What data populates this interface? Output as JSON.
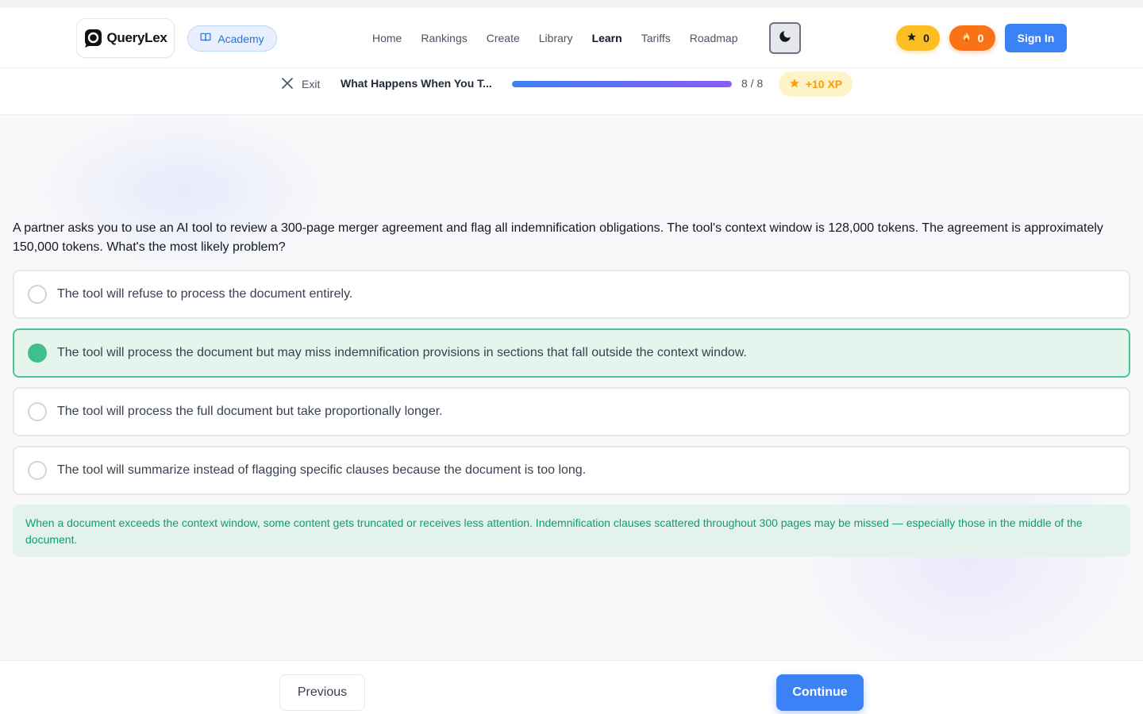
{
  "header": {
    "brand": "QueryLex",
    "academy_label": "Academy",
    "nav": [
      "Home",
      "Rankings",
      "Create",
      "Library",
      "Learn",
      "Tariffs",
      "Roadmap"
    ],
    "active_nav": "Learn",
    "xp_count": "0",
    "streak_count": "0",
    "signin_label": "Sign In"
  },
  "lesson": {
    "exit_label": "Exit",
    "title": "What Happens When You T...",
    "progress_text": "8 / 8",
    "progress_fraction": 1.0,
    "reward_label": "+10 XP"
  },
  "quiz": {
    "question": "A partner asks you to use an AI tool to review a 300-page merger agreement and flag all indemnification obligations. The tool's context window is 128,000 tokens. The agreement is approximately 150,000 tokens. What's the most likely problem?",
    "options": [
      "The tool will refuse to process the document entirely.",
      "The tool will process the document but may miss indemnification provisions in sections that fall outside the context window.",
      "The tool will process the full document but take proportionally longer.",
      "The tool will summarize instead of flagging specific clauses because the document is too long."
    ],
    "selected_index": 1,
    "explanation": "When a document exceeds the context window, some content gets truncated or receives less attention. Indemnification clauses scattered throughout 300 pages may be missed — especially those in the middle of the document."
  },
  "footer": {
    "previous_label": "Previous",
    "continue_label": "Continue"
  },
  "colors": {
    "primary": "#3b82f6",
    "success": "#3fbf8c",
    "xp": "#fbbf24",
    "streak": "#f97316"
  },
  "icons": {
    "logo": "querylex-logo-icon",
    "academy": "book-open-icon",
    "theme": "moon-icon",
    "xp": "star-icon",
    "streak": "flame-icon",
    "exit": "close-icon",
    "reward": "star-icon"
  }
}
